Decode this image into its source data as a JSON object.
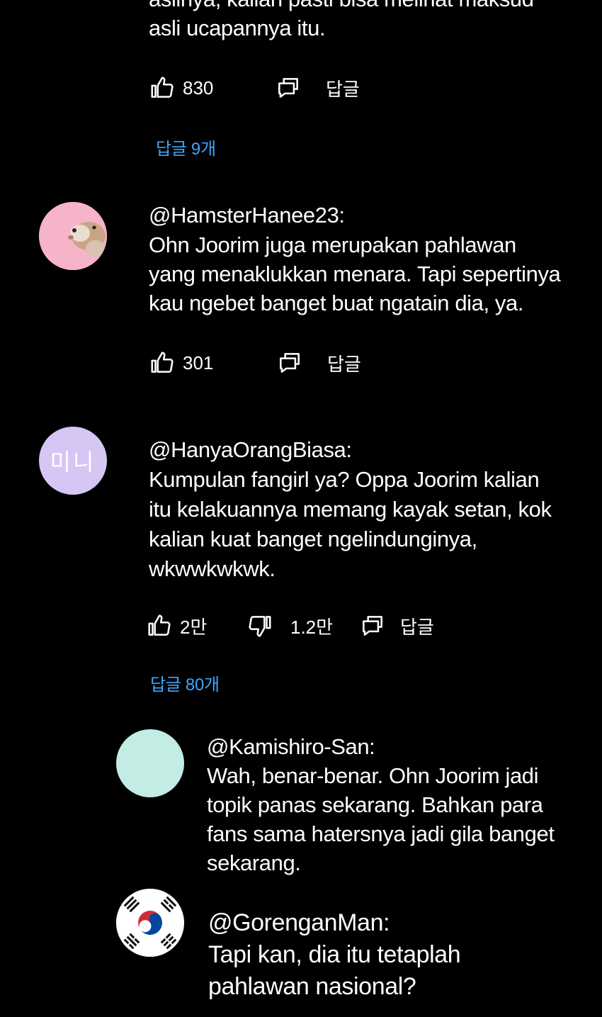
{
  "comments": [
    {
      "lines": [
        "aslinya, kalian pasti bisa melihat maksud",
        "asli ucapannya itu."
      ],
      "likes": "830",
      "reply_label": "답글",
      "replies_link": "답글 9개"
    },
    {
      "handle": "@HamsterHanee23:",
      "lines": [
        "Ohn Joorim juga merupakan pahlawan",
        "yang menaklukkan menara. Tapi sepertinya",
        "kau ngebet banget buat ngatain dia, ya."
      ],
      "likes": "301",
      "reply_label": "답글"
    },
    {
      "handle": "@HanyaOrangBiasa:",
      "avatar_text": "미니",
      "lines": [
        "Kumpulan fangirl ya? Oppa Joorim kalian",
        "itu kelakuannya memang kayak setan, kok",
        "kalian kuat banget ngelindunginya,",
        "wkwwkwkwk."
      ],
      "likes": "2만",
      "dislikes": "1.2만",
      "reply_label": "답글",
      "replies_link": "답글 80개"
    }
  ],
  "replies": [
    {
      "handle": "@Kamishiro-San:",
      "lines": [
        "Wah, benar-benar. Ohn Joorim jadi",
        "topik panas sekarang. Bahkan para",
        "fans sama hatersnya jadi gila banget",
        "sekarang."
      ]
    },
    {
      "handle": "@GorenganMan:",
      "lines": [
        "Tapi kan, dia itu tetaplah",
        "pahlawan nasional?"
      ]
    }
  ],
  "colors": {
    "background": "#000000",
    "text": "#ffffff",
    "link": "#3ea6ff"
  },
  "icons": [
    "thumb-up-icon",
    "thumb-down-icon",
    "reply-icon",
    "hamster-avatar",
    "korean-flag-avatar"
  ]
}
